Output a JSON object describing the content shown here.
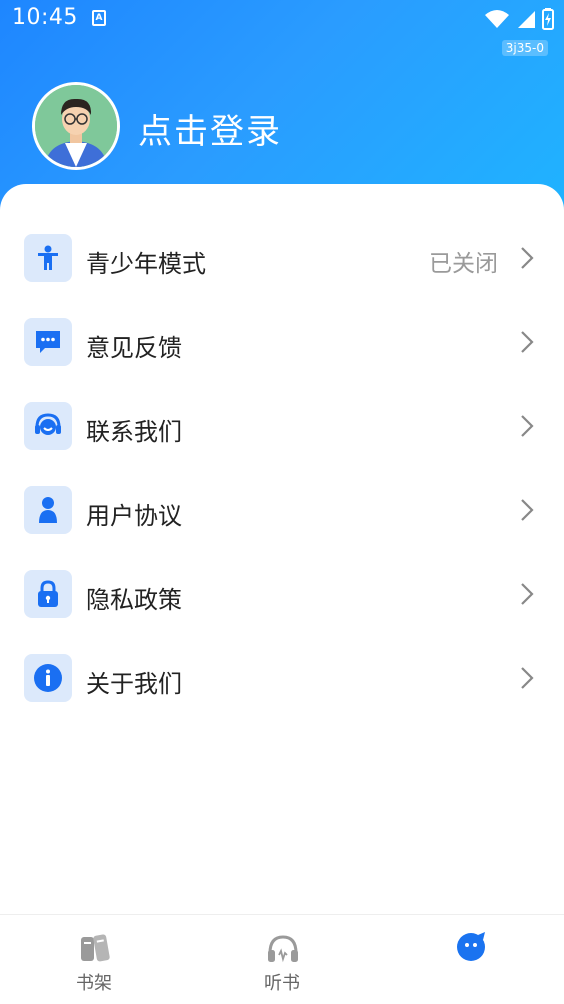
{
  "status_bar": {
    "time": "10:45",
    "notification_letter": "A",
    "version_badge": "3j35-0"
  },
  "header": {
    "login_prompt": "点击登录"
  },
  "menu": {
    "items": [
      {
        "label": "青少年模式",
        "status": "已关闭",
        "icon": "child-icon"
      },
      {
        "label": "意见反馈",
        "icon": "chat-bubble-icon"
      },
      {
        "label": "联系我们",
        "icon": "headset-icon"
      },
      {
        "label": "用户协议",
        "icon": "person-icon"
      },
      {
        "label": "隐私政策",
        "icon": "lock-icon"
      },
      {
        "label": "关于我们",
        "icon": "info-icon"
      }
    ]
  },
  "tabbar": {
    "tabs": [
      {
        "label": "书架",
        "icon": "bookshelf-icon"
      },
      {
        "label": "听书",
        "icon": "headphones-icon"
      },
      {
        "label": "",
        "icon": "mascot-icon",
        "active": true
      }
    ]
  },
  "colors": {
    "brand_blue": "#1e86ff",
    "icon_tile": "#dce9fb",
    "icon_blue": "#1a6ff2",
    "active_tab": "#1a73f0"
  }
}
